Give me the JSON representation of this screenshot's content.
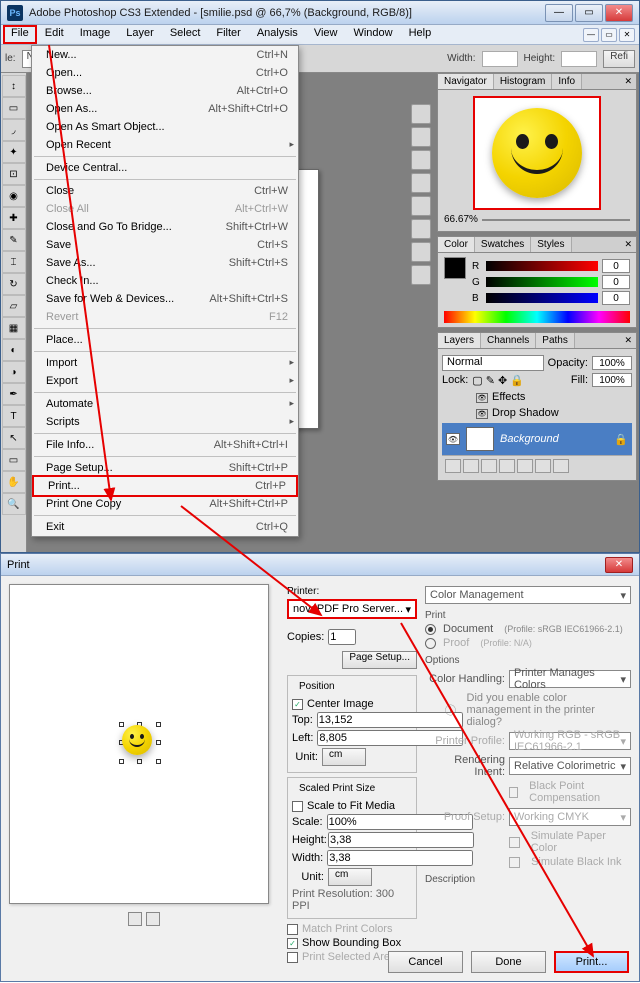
{
  "top_window": {
    "title": "Adobe Photoshop CS3 Extended - [smilie.psd @ 66,7% (Background, RGB/8)]",
    "menus": [
      "File",
      "Edit",
      "Image",
      "Layer",
      "Select",
      "Filter",
      "Analysis",
      "View",
      "Window",
      "Help"
    ],
    "option_bar": {
      "style_label": "le:",
      "style_value": "Normal",
      "width_label": "Width:",
      "height_label": "Height:",
      "refine_btn": "Refi"
    },
    "file_menu": [
      {
        "label": "New...",
        "accel": "Ctrl+N"
      },
      {
        "label": "Open...",
        "accel": "Ctrl+O"
      },
      {
        "label": "Browse...",
        "accel": "Alt+Ctrl+O"
      },
      {
        "label": "Open As...",
        "accel": "Alt+Shift+Ctrl+O"
      },
      {
        "label": "Open As Smart Object...",
        "accel": ""
      },
      {
        "label": "Open Recent",
        "accel": "",
        "sub": true
      },
      {
        "sep": true
      },
      {
        "label": "Device Central...",
        "accel": ""
      },
      {
        "sep": true
      },
      {
        "label": "Close",
        "accel": "Ctrl+W"
      },
      {
        "label": "Close All",
        "accel": "Alt+Ctrl+W",
        "dis": true
      },
      {
        "label": "Close and Go To Bridge...",
        "accel": "Shift+Ctrl+W"
      },
      {
        "label": "Save",
        "accel": "Ctrl+S"
      },
      {
        "label": "Save As...",
        "accel": "Shift+Ctrl+S"
      },
      {
        "label": "Check In...",
        "accel": ""
      },
      {
        "label": "Save for Web & Devices...",
        "accel": "Alt+Shift+Ctrl+S"
      },
      {
        "label": "Revert",
        "accel": "F12",
        "dis": true
      },
      {
        "sep": true
      },
      {
        "label": "Place...",
        "accel": ""
      },
      {
        "sep": true
      },
      {
        "label": "Import",
        "accel": "",
        "sub": true
      },
      {
        "label": "Export",
        "accel": "",
        "sub": true
      },
      {
        "sep": true
      },
      {
        "label": "Automate",
        "accel": "",
        "sub": true
      },
      {
        "label": "Scripts",
        "accel": "",
        "sub": true
      },
      {
        "sep": true
      },
      {
        "label": "File Info...",
        "accel": "Alt+Shift+Ctrl+I"
      },
      {
        "sep": true
      },
      {
        "label": "Page Setup...",
        "accel": "Shift+Ctrl+P"
      },
      {
        "label": "Print...",
        "accel": "Ctrl+P",
        "hl": true
      },
      {
        "label": "Print One Copy",
        "accel": "Alt+Shift+Ctrl+P"
      },
      {
        "sep": true
      },
      {
        "label": "Exit",
        "accel": "Ctrl+Q"
      }
    ],
    "navigator": {
      "tabs": [
        "Navigator",
        "Histogram",
        "Info"
      ],
      "zoom": "66.67%"
    },
    "color": {
      "tabs": [
        "Color",
        "Swatches",
        "Styles"
      ],
      "r_label": "R",
      "g_label": "G",
      "b_label": "B",
      "r": "0",
      "g": "0",
      "b": "0"
    },
    "layers": {
      "tabs": [
        "Layers",
        "Channels",
        "Paths"
      ],
      "blend": "Normal",
      "opacity_label": "Opacity:",
      "opacity": "100%",
      "lock_label": "Lock:",
      "fill_label": "Fill:",
      "fill": "100%",
      "effects_label": "Effects",
      "dropshadow_label": "Drop Shadow",
      "bg_layer": "Background"
    }
  },
  "print_dialog": {
    "title": "Print",
    "printer_label": "Printer:",
    "printer_value": "novaPDF Pro Server...",
    "copies_label": "Copies:",
    "copies": "1",
    "page_setup_btn": "Page Setup...",
    "position_title": "Position",
    "center_image": "Center Image",
    "top_label": "Top:",
    "top": "13,152",
    "left_label": "Left:",
    "left": "8,805",
    "unit_label": "Unit:",
    "unit": "cm",
    "scaled_title": "Scaled Print Size",
    "scale_fit": "Scale to Fit Media",
    "scale_label": "Scale:",
    "scale": "100%",
    "height_label": "Height:",
    "height": "3,38",
    "width_label": "Width:",
    "width": "3,38",
    "print_res": "Print Resolution: 300 PPI",
    "match_colors": "Match Print Colors",
    "show_bbox": "Show Bounding Box",
    "print_sel": "Print Selected Area",
    "cm_dd": "Color Management",
    "print_section": "Print",
    "document_radio": "Document",
    "document_profile": "(Profile: sRGB IEC61966-2.1)",
    "proof_radio": "Proof",
    "proof_profile": "(Profile: N/A)",
    "options_section": "Options",
    "color_handling_label": "Color Handling:",
    "color_handling": "Printer Manages Colors",
    "hint": "Did you enable color management in the printer dialog?",
    "printer_profile_label": "Printer Profile:",
    "printer_profile": "Working RGB - sRGB IEC61966-2.1",
    "rendering_label": "Rendering Intent:",
    "rendering": "Relative Colorimetric",
    "bpc": "Black Point Compensation",
    "proof_setup_label": "Proof Setup:",
    "proof_setup": "Working CMYK",
    "sim_paper": "Simulate Paper Color",
    "sim_black": "Simulate Black Ink",
    "desc_label": "Description",
    "cancel_btn": "Cancel",
    "done_btn": "Done",
    "print_btn": "Print..."
  }
}
